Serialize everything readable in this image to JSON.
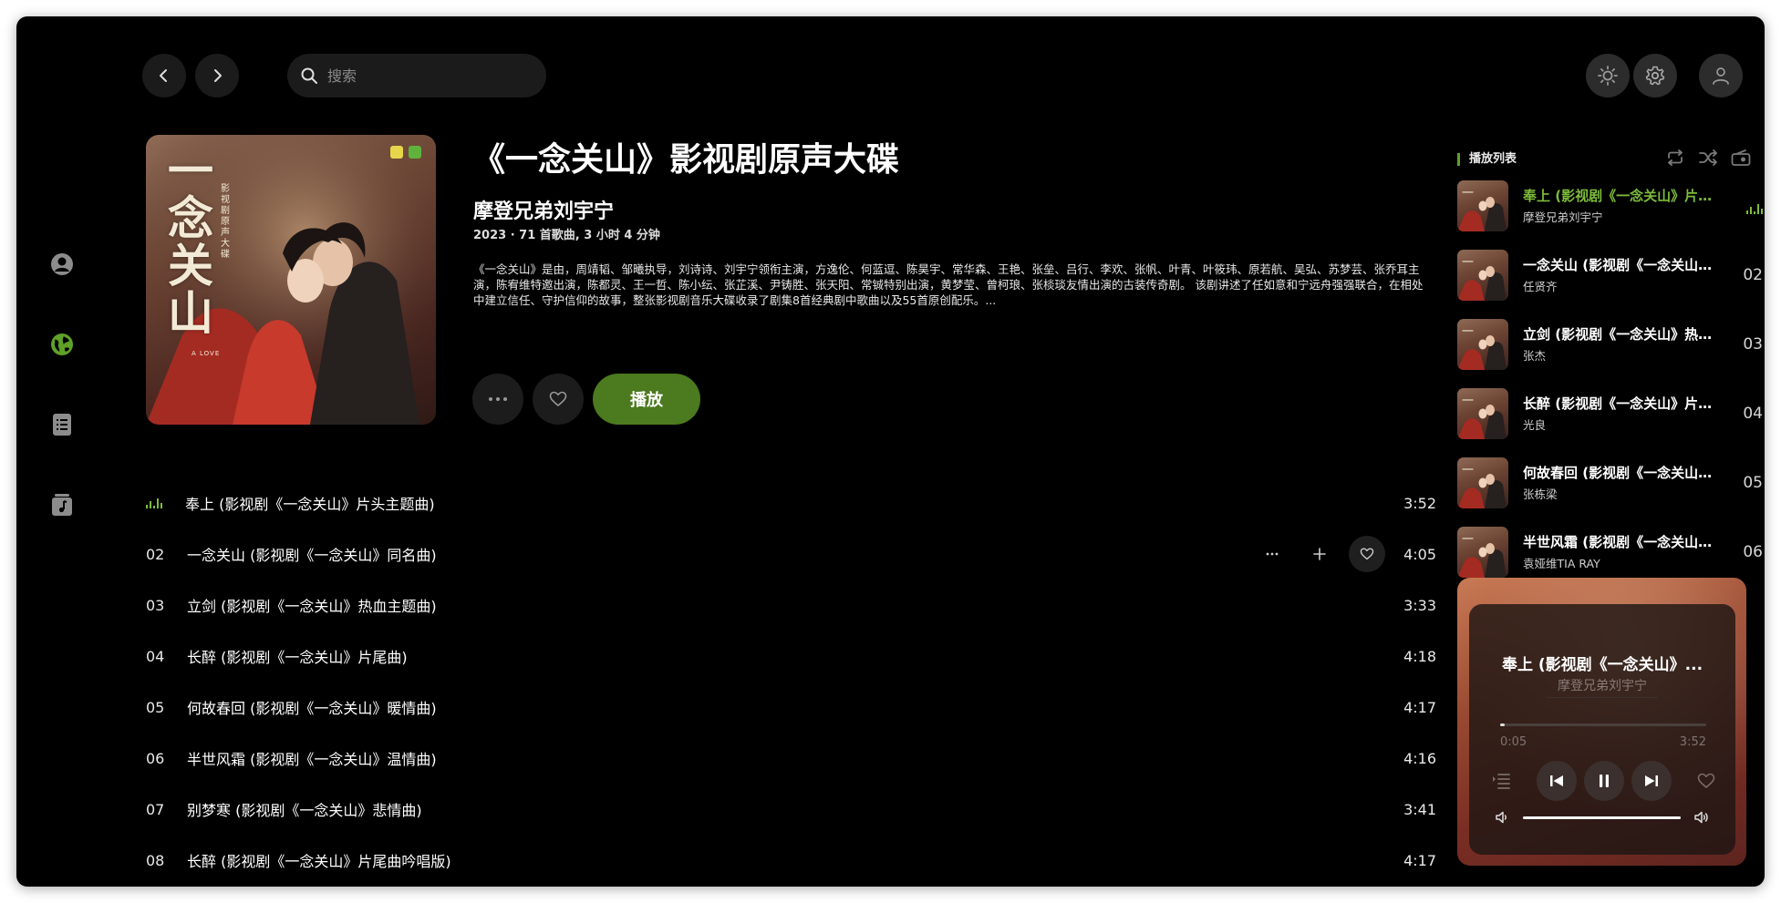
{
  "search": {
    "placeholder": "搜索"
  },
  "album": {
    "title": "《一念关山》影视剧原声大碟",
    "artist": "摩登兄弟刘宇宁",
    "meta": "2023 · 71 首歌曲, 3 小时 4 分钟",
    "description": "《一念关山》是由，周靖韬、邹曦执导，刘诗诗、刘宇宁领衔主演，方逸伦、何蓝逗、陈昊宇、常华森、王艳、张垒、吕行、李欢、张帆、叶青、叶筱玮、原若航、吴弘、苏梦芸、张乔耳主演，陈宥维特邀出演，陈都灵、王一哲、陈小纭、张芷溪、尹铸胜、张天阳、常铖特别出演，黄梦莹、曾柯琅、张棪琰友情出演的古装传奇剧。 该剧讲述了任如意和宁远舟强强联合，在相处中建立信任、守护信仰的故事，整张影视剧音乐大碟收录了剧集8首经典剧中歌曲以及55首原创配乐。...",
    "play_label": "播放",
    "cover_text": "一念关山",
    "cover_subtitle": "影视剧原声大碟",
    "cover_latin": "A LOVE"
  },
  "tracks": [
    {
      "num": "",
      "name": "奉上 (影视剧《一念关山》片头主题曲)",
      "duration": "3:52",
      "playing": true
    },
    {
      "num": "02",
      "name": "一念关山 (影视剧《一念关山》同名曲)",
      "duration": "4:05",
      "hovered": true
    },
    {
      "num": "03",
      "name": "立剑 (影视剧《一念关山》热血主题曲)",
      "duration": "3:33"
    },
    {
      "num": "04",
      "name": "长醉 (影视剧《一念关山》片尾曲)",
      "duration": "4:18"
    },
    {
      "num": "05",
      "name": "何故春回 (影视剧《一念关山》暖情曲)",
      "duration": "4:17"
    },
    {
      "num": "06",
      "name": "半世风霜 (影视剧《一念关山》温情曲)",
      "duration": "4:16"
    },
    {
      "num": "07",
      "name": "别梦寒 (影视剧《一念关山》悲情曲)",
      "duration": "3:41"
    },
    {
      "num": "08",
      "name": "长醉 (影视剧《一念关山》片尾曲吟唱版)",
      "duration": "4:17"
    }
  ],
  "playlist": {
    "header": "播放列表",
    "items": [
      {
        "title": "奉上 (影视剧《一念关山》片头主题曲)",
        "artist": "摩登兄弟刘宇宁",
        "num": "",
        "playing": true
      },
      {
        "title": "一念关山 (影视剧《一念关山》同名曲)",
        "artist": "任贤齐",
        "num": "02"
      },
      {
        "title": "立剑 (影视剧《一念关山》热血主题曲)",
        "artist": "张杰",
        "num": "03"
      },
      {
        "title": "长醉 (影视剧《一念关山》片尾曲)",
        "artist": "光良",
        "num": "04"
      },
      {
        "title": "何故春回 (影视剧《一念关山》暖情曲)",
        "artist": "张栋梁",
        "num": "05"
      },
      {
        "title": "半世风霜 (影视剧《一念关山》温情曲)",
        "artist": "袁娅维TIA RAY",
        "num": "06"
      }
    ]
  },
  "now_playing": {
    "title": "奉上 (影视剧《一念关山》...",
    "artist": "摩登兄弟刘宇宁",
    "elapsed": "0:05",
    "total": "3:52",
    "progress_fraction": 0.022,
    "volume_fraction": 1.0
  },
  "colors": {
    "accent": "#5fa127",
    "play_button": "#4c7a1f",
    "playing_text": "#7dbb3a"
  },
  "icons": [
    "back-icon",
    "forward-icon",
    "search-icon",
    "theme-sun-icon",
    "settings-gear-icon",
    "user-icon",
    "profile-icon",
    "explore-globe-icon",
    "library-list-icon",
    "music-note-icon",
    "more-icon",
    "heart-icon",
    "plus-icon",
    "repeat-icon",
    "shuffle-icon",
    "radio-icon",
    "playlist-icon",
    "previous-icon",
    "pause-icon",
    "next-icon",
    "volume-low-icon",
    "volume-high-icon",
    "equalizer-icon"
  ]
}
